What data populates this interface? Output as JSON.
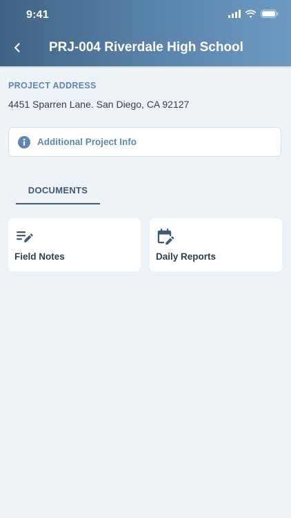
{
  "status_bar": {
    "time": "9:41",
    "icons": [
      "signal-icon",
      "wifi-icon",
      "battery-icon"
    ]
  },
  "header": {
    "back_icon": "chevron-left-icon",
    "title": "PRJ-004 Riverdale High School"
  },
  "project_address": {
    "label": "PROJECT ADDRESS",
    "value": "4451 Sparren Lane. San Diego, CA 92127"
  },
  "additional_info": {
    "icon": "info-icon",
    "label": "Additional Project Info"
  },
  "tabs": [
    {
      "label": "DOCUMENTS",
      "active": true
    }
  ],
  "documents": [
    {
      "icon": "notes-edit-icon",
      "label": "Field Notes"
    },
    {
      "icon": "calendar-edit-icon",
      "label": "Daily Reports"
    }
  ],
  "colors": {
    "header_gradient_start": "#3f6384",
    "header_gradient_end": "#6e99c2",
    "accent": "#5f86ad",
    "tab_active": "#3e5875",
    "background": "#eef3f8",
    "card": "#ffffff",
    "text": "#2f3e4f"
  }
}
